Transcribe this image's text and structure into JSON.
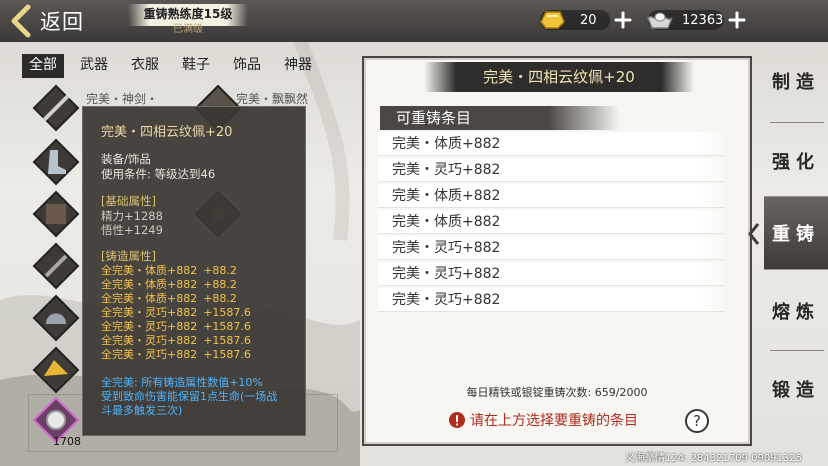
{
  "topbar": {
    "back_label": "返回",
    "mastery_title": "重铸熟练度15级",
    "mastery_sub": "已满级",
    "gold_value": "20",
    "silver_value": "12363"
  },
  "tabs": [
    {
      "label": "全部",
      "active": true
    },
    {
      "label": "武器",
      "active": false
    },
    {
      "label": "衣服",
      "active": false
    },
    {
      "label": "鞋子",
      "active": false
    },
    {
      "label": "饰品",
      "active": false
    },
    {
      "label": "神器",
      "active": false
    }
  ],
  "items": {
    "label_1": "完美・神剑・",
    "label_2": "完美・飘飘然",
    "slot_count": "1708"
  },
  "tooltip": {
    "name": "完美・四相云纹佩+20",
    "type": "装备/饰品",
    "requirement": "使用条件:   等级达到46",
    "base_section": "[基础属性]",
    "base_attrs": [
      "精力+1288",
      "悟性+1249"
    ],
    "forge_section": "[铸造属性]",
    "forge_attrs": [
      {
        "text": "全完美・体质+882",
        "bonus": "+88.2"
      },
      {
        "text": "全完美・体质+882",
        "bonus": "+88.2"
      },
      {
        "text": "全完美・体质+882",
        "bonus": "+88.2"
      },
      {
        "text": "全完美・灵巧+882",
        "bonus": "+1587.6"
      },
      {
        "text": "全完美・灵巧+882",
        "bonus": "+1587.6"
      },
      {
        "text": "全完美・灵巧+882",
        "bonus": "+1587.6"
      },
      {
        "text": "全完美・灵巧+882",
        "bonus": "+1587.6"
      }
    ],
    "set_bonus_1": "全完美: 所有铸造属性数值+10%",
    "set_bonus_2": "受到致命伤害能保留1点生命(一场战",
    "set_bonus_3": "斗最多触发三次)"
  },
  "panel": {
    "title": "完美・四相云纹佩+20",
    "reforge_header": "可重铸条目",
    "entries": [
      "完美・体质+882",
      "完美・灵巧+882",
      "完美・体质+882",
      "完美・体质+882",
      "完美・灵巧+882",
      "完美・灵巧+882",
      "完美・灵巧+882"
    ],
    "daily_count": "每日精铁或银锭重铸次数: 659/2000",
    "hint": "请在上方选择要重铸的条目"
  },
  "side_nav": [
    {
      "label": "制造",
      "active": false
    },
    {
      "label": "强化",
      "active": false
    },
    {
      "label": "重铸",
      "active": true
    },
    {
      "label": "熔炼",
      "active": false
    },
    {
      "label": "锻造",
      "active": false
    }
  ],
  "footer": {
    "id_text": "义海豪情124: 284321709 09091325"
  },
  "colors": {
    "forge_gold": "#f2c24a",
    "set_blue": "#4ab4ff",
    "hint_red": "#b02c1c"
  }
}
